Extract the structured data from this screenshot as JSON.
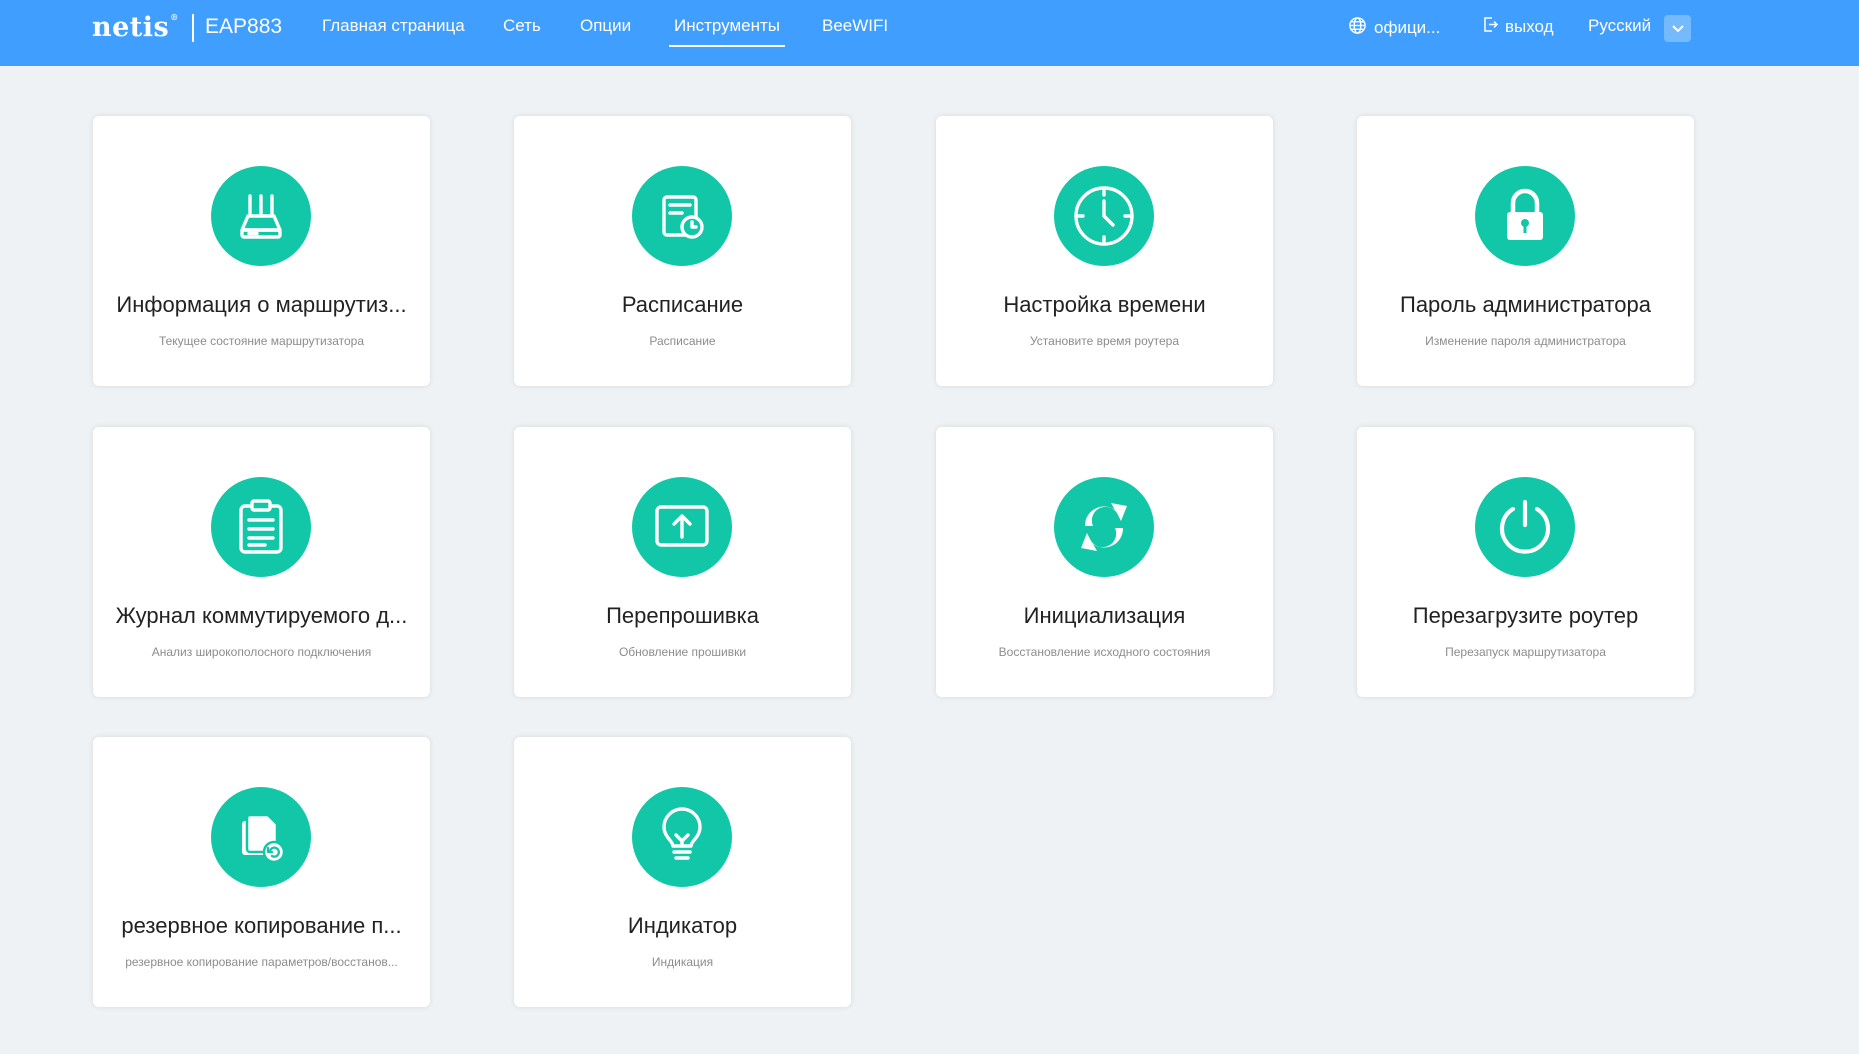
{
  "header": {
    "logo": "netis",
    "logo_mark": "®",
    "model": "EAP883",
    "nav": [
      {
        "label": "Главная страница"
      },
      {
        "label": "Сеть"
      },
      {
        "label": "Опции"
      },
      {
        "label": "Инструменты"
      },
      {
        "label": "BeeWIFI"
      }
    ],
    "active_nav": "Инструменты",
    "official": "офици...",
    "logout": "выход",
    "language": "Русский",
    "colors": {
      "bar": "#409eff",
      "accent": "#12c7a8"
    }
  },
  "cards": [
    {
      "title": "Информация о маршрутиз...",
      "sub": "Текущее состояние маршрутизатора",
      "icon": "router-icon"
    },
    {
      "title": "Расписание",
      "sub": "Расписание",
      "icon": "schedule-icon"
    },
    {
      "title": "Настройка времени",
      "sub": "Установите время роутера",
      "icon": "clock-icon"
    },
    {
      "title": "Пароль администратора",
      "sub": "Изменение пароля администратора",
      "icon": "lock-icon"
    },
    {
      "title": "Журнал коммутируемого д...",
      "sub": "Анализ широкополосного подключения",
      "icon": "clipboard-icon"
    },
    {
      "title": "Перепрошивка",
      "sub": "Обновление прошивки",
      "icon": "upload-icon"
    },
    {
      "title": "Инициализация",
      "sub": "Восстановление исходного состояния",
      "icon": "reset-icon"
    },
    {
      "title": "Перезагрузите роутер",
      "sub": "Перезапуск маршрутизатора",
      "icon": "power-icon"
    },
    {
      "title": "резервное копирование п...",
      "sub": "резервное копирование параметров/восстанов...",
      "icon": "backup-icon"
    },
    {
      "title": "Индикатор",
      "sub": "Индикация",
      "icon": "bulb-icon"
    }
  ]
}
